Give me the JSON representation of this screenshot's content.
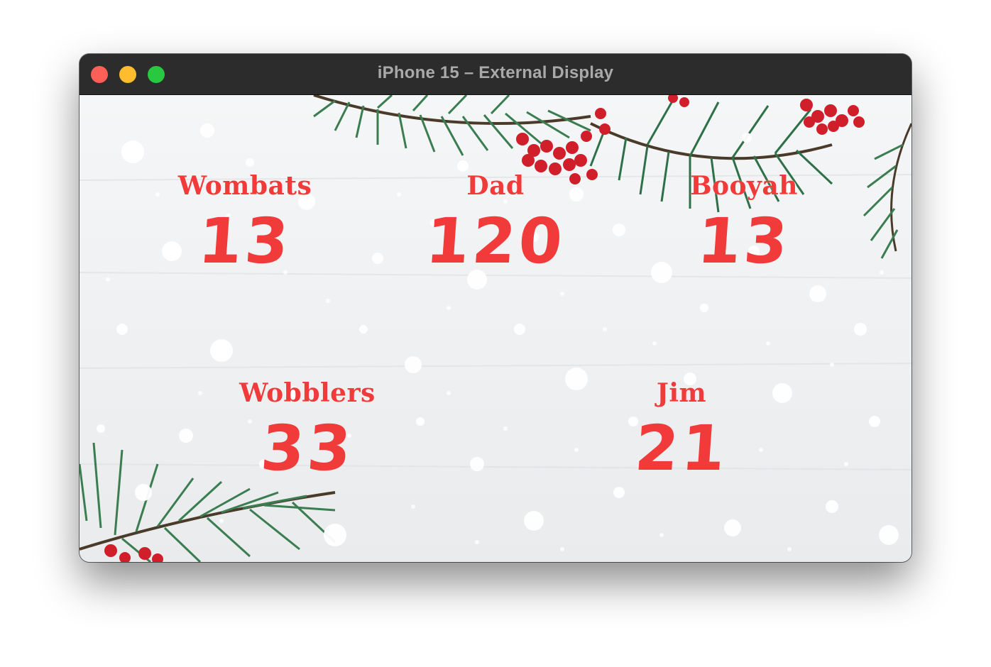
{
  "window": {
    "title": "iPhone 15 – External Display"
  },
  "colors": {
    "score_red": "#f13a3a",
    "titlebar": "#2c2c2c"
  },
  "teams": [
    {
      "name": "Wombats",
      "score": "13"
    },
    {
      "name": "Dad",
      "score": "120"
    },
    {
      "name": "Booyah",
      "score": "13"
    },
    {
      "name": "Wobblers",
      "score": "33"
    },
    {
      "name": "Jim",
      "score": "21"
    }
  ]
}
